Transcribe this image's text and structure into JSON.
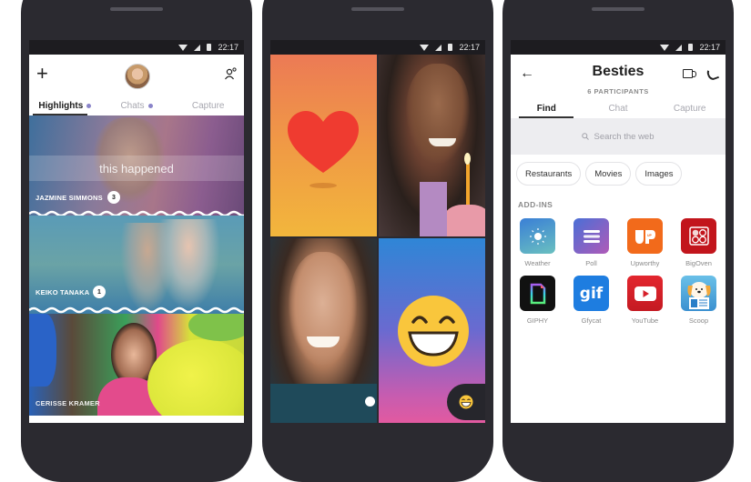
{
  "status": {
    "time": "22:17"
  },
  "phone1": {
    "tabs": [
      {
        "label": "Highlights",
        "active": true,
        "dot": true
      },
      {
        "label": "Chats",
        "active": false,
        "dot": true
      },
      {
        "label": "Capture",
        "active": false,
        "dot": false
      }
    ],
    "stories": [
      {
        "name": "JAZMINE SIMMONS",
        "count": "3",
        "caption": "this happened"
      },
      {
        "name": "KEIKO TANAKA",
        "count": "1"
      },
      {
        "name": "CERISSE KRAMER"
      }
    ]
  },
  "phone2": {
    "tiles": [
      "heart-sticker",
      "video-participant-1",
      "video-participant-2",
      "emoji-sticker"
    ],
    "reaction_button": "laughing-emoji"
  },
  "phone3": {
    "title": "Besties",
    "subtitle": "6 PARTICIPANTS",
    "tabs": [
      {
        "label": "Find",
        "active": true
      },
      {
        "label": "Chat",
        "active": false
      },
      {
        "label": "Capture",
        "active": false
      }
    ],
    "search_placeholder": "Search the web",
    "chips": [
      "Restaurants",
      "Movies",
      "Images"
    ],
    "addins_title": "ADD-INS",
    "addins": [
      {
        "label": "Weather",
        "color": "#3a8fd6"
      },
      {
        "label": "Poll",
        "color": "#6a5fcf"
      },
      {
        "label": "Upworthy",
        "color": "#f26a1b"
      },
      {
        "label": "BigOven",
        "color": "#c2151c"
      },
      {
        "label": "GIPHY",
        "color": "#111111"
      },
      {
        "label": "Gfycat",
        "color": "#1e7de0"
      },
      {
        "label": "YouTube",
        "color": "#d6202a"
      },
      {
        "label": "Scoop",
        "color": "#3aa0dc"
      }
    ]
  }
}
